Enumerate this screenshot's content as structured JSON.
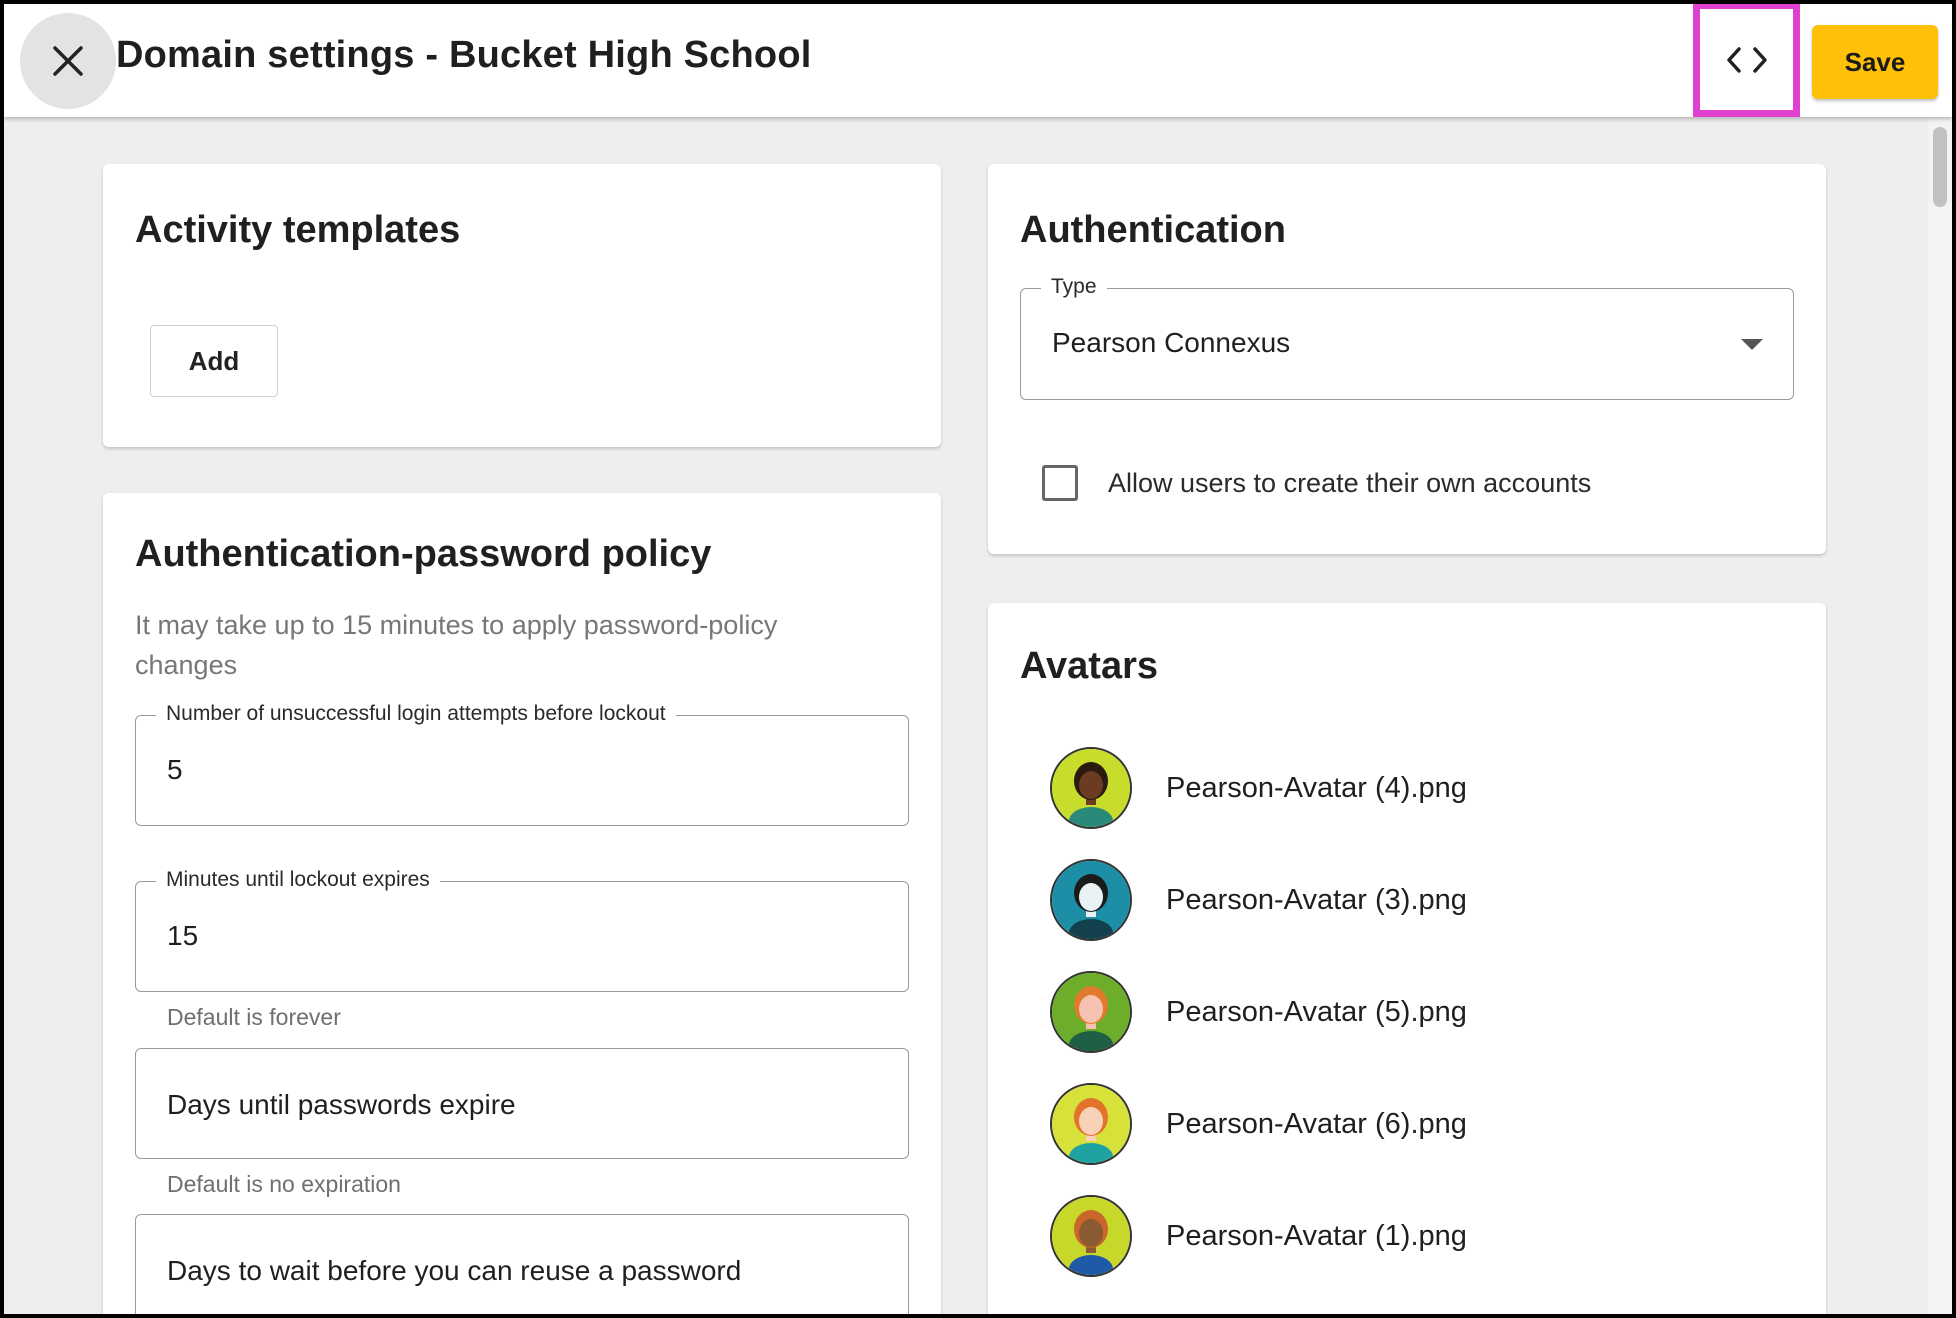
{
  "header": {
    "title": "Domain settings - Bucket High School",
    "save_label": "Save"
  },
  "activity_templates": {
    "title": "Activity templates",
    "add_label": "Add"
  },
  "password_policy": {
    "title": "Authentication-password policy",
    "description": "It may take up to 15 minutes to apply password-policy changes",
    "fields": [
      {
        "label": "Number of unsuccessful login attempts before lockout",
        "value": "5",
        "helper": ""
      },
      {
        "label": "Minutes until lockout expires",
        "value": "15",
        "helper": "Default is forever"
      },
      {
        "label": "",
        "placeholder": "Days until passwords expire",
        "helper": "Default is no expiration"
      },
      {
        "label": "",
        "placeholder": "Days to wait before you can reuse a password",
        "helper": ""
      }
    ]
  },
  "authentication": {
    "title": "Authentication",
    "type_label": "Type",
    "type_value": "Pearson Connexus",
    "allow_self_signup_label": "Allow users to create their own accounts",
    "allow_self_signup_checked": false
  },
  "avatars": {
    "title": "Avatars",
    "items": [
      {
        "name": "Pearson-Avatar (4).png",
        "bg": "#c8dc2c",
        "skin": "#6b3b22",
        "hair": "#2b1a10",
        "shirt": "#2a8a7a"
      },
      {
        "name": "Pearson-Avatar (3).png",
        "bg": "#1c8fa6",
        "skin": "#e9f1f2",
        "hair": "#1b1b1b",
        "shirt": "#12404c"
      },
      {
        "name": "Pearson-Avatar (5).png",
        "bg": "#6cae2a",
        "skin": "#f6c2b2",
        "hair": "#e07a2c",
        "shirt": "#1f5f46"
      },
      {
        "name": "Pearson-Avatar (6).png",
        "bg": "#d6e23a",
        "skin": "#f7d2b8",
        "hair": "#e3722a",
        "shirt": "#1ea2a2"
      },
      {
        "name": "Pearson-Avatar (1).png",
        "bg": "#c8d82a",
        "skin": "#8a5a33",
        "hair": "#c9662a",
        "shirt": "#1e5aa8"
      }
    ]
  }
}
